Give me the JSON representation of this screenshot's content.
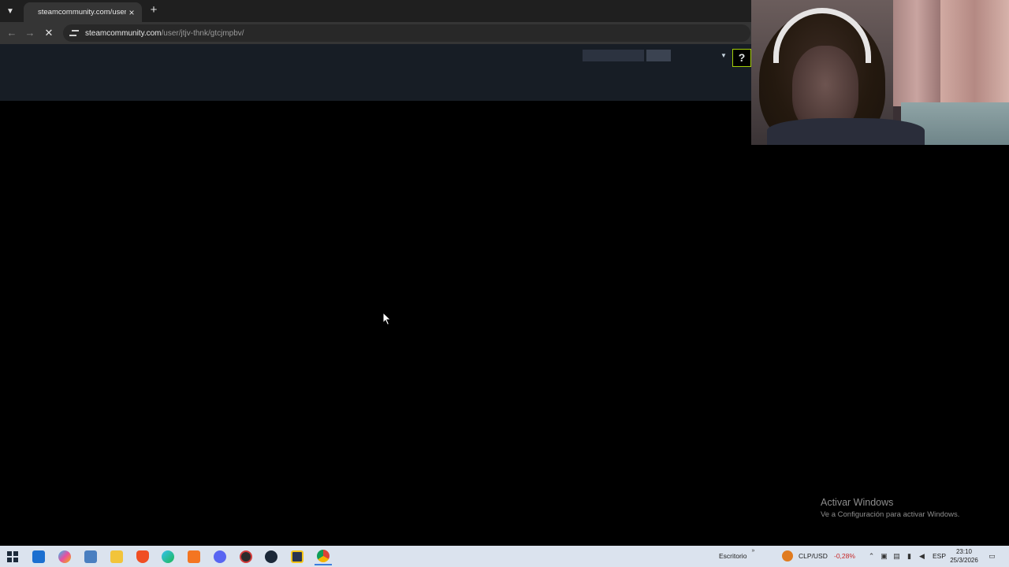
{
  "browser": {
    "tab_title": "steamcommunity.com/user/jtjv",
    "tab_close": "×",
    "new_tab": "+",
    "url_host": "steamcommunity.com",
    "url_path": "/user/jtjv-thnk/gtcjmpbv/"
  },
  "steam_header": {
    "help_label": "?",
    "accent_color": "#a4d007"
  },
  "watermark": {
    "title": "Activar Windows",
    "subtitle": "Ve a Configuración para activar Windows."
  },
  "taskbar": {
    "icons": [
      "start-icon",
      "outlook-icon",
      "copilot-icon",
      "notepad-icon",
      "file-explorer-icon",
      "brave-icon",
      "edge-icon",
      "crunchyroll-icon",
      "discord-icon",
      "app-icon",
      "steam-icon",
      "winamp-icon",
      "chrome-icon"
    ],
    "desktop_label": "Escritorio",
    "currency_label": "CLP/USD",
    "currency_change": "-0,28%",
    "language": "ESP",
    "time": "23:10",
    "date": "25/3/2026"
  }
}
